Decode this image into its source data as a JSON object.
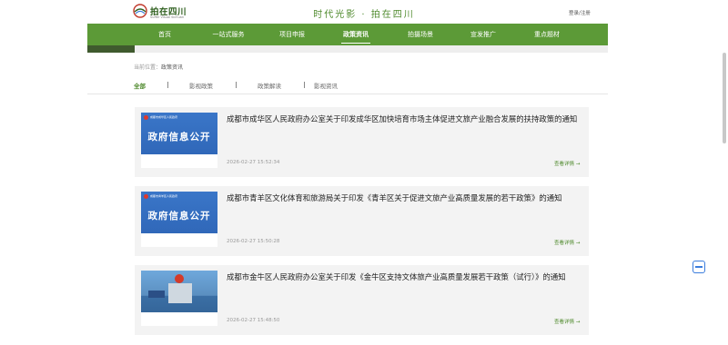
{
  "header": {
    "logo_text": "拍在四川",
    "logo_sub": "Suffer Visual Sichuan",
    "slogan": "时代光影 · 拍在四川",
    "login": "登录/注册"
  },
  "nav": {
    "items": [
      "首页",
      "一站式服务",
      "项目申报",
      "政策资讯",
      "拍摄场景",
      "宣发推广",
      "重点题材"
    ],
    "active": "政策资讯"
  },
  "breadcrumb": {
    "prefix": "当前位置：",
    "current": "政策资讯"
  },
  "filters": {
    "items": [
      "全部",
      "影视政策",
      "政策解读",
      "影视资讯"
    ],
    "active": "全部"
  },
  "articles": [
    {
      "title": "成都市成华区人民政府办公室关于印发成华区加快培育市场主体促进文旅产业融合发展的扶持政策的通知",
      "date": "2026-02-27 15:52:34",
      "more": "查看详情 →",
      "thumb_title": "政府信息公开",
      "thumb_org": "成都市成华区人民政府"
    },
    {
      "title": "成都市青羊区文化体育和旅游局关于印发《青羊区关于促进文旅产业高质量发展的若干政策》的通知",
      "date": "2026-02-27 15:50:28",
      "more": "查看详情 →",
      "thumb_title": "政府信息公开",
      "thumb_org": "成都市青羊区人民政府"
    },
    {
      "title": "成都市金牛区人民政府办公室关于印发《金牛区支持文体旅产业高质量发展若干政策（试行）》的通知",
      "date": "2026-02-27 15:48:50",
      "more": "查看详情 →",
      "thumb_title": "",
      "thumb_org": ""
    }
  ],
  "colors": {
    "brand_green": "#5c9a37",
    "accent_green": "#4f8a2d",
    "card_bg": "#f3f3f3",
    "thumb_blue": "#2d63b4"
  }
}
